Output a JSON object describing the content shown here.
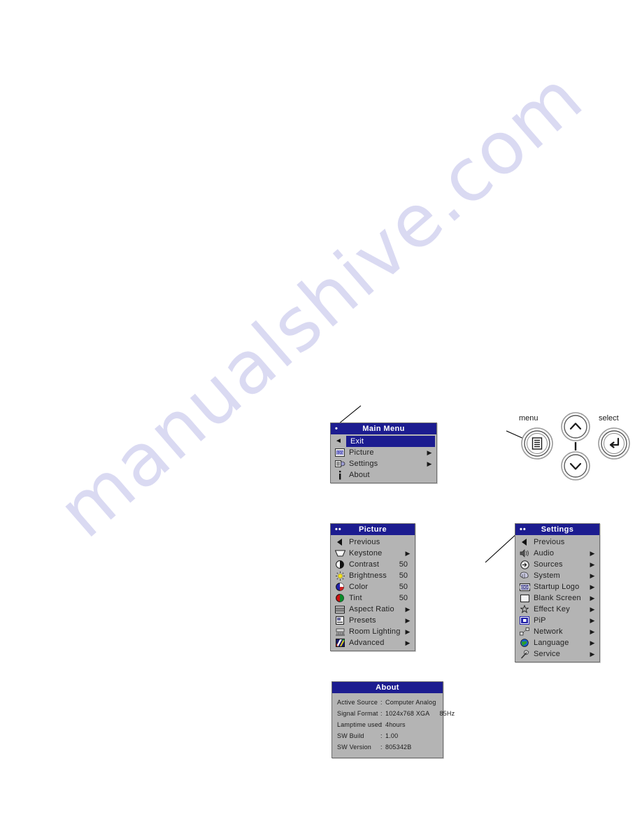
{
  "watermark": {
    "text": "manualshive.com"
  },
  "colors": {
    "title_bar": "#1c1c90",
    "panel_bg": "#b4b4b4",
    "highlight": "#1c1c90",
    "panel_border": "#6e6e6e"
  },
  "main_menu": {
    "title": "Main Menu",
    "title_dots": "•",
    "items": [
      {
        "label": "Exit",
        "icon": "left-arrow-icon",
        "arrow": "",
        "selected": true
      },
      {
        "label": "Picture",
        "icon": "picture-icon",
        "arrow": "▶",
        "selected": false
      },
      {
        "label": "Settings",
        "icon": "settings-icon",
        "arrow": "▶",
        "selected": false
      },
      {
        "label": "About",
        "icon": "info-icon",
        "arrow": "",
        "selected": false
      }
    ]
  },
  "picture_menu": {
    "title": "Picture",
    "title_dots": "••",
    "items": [
      {
        "label": "Previous",
        "icon": "left-arrow-icon",
        "value": "",
        "arrow": ""
      },
      {
        "label": "Keystone",
        "icon": "keystone-icon",
        "value": "",
        "arrow": "▶"
      },
      {
        "label": "Contrast",
        "icon": "contrast-icon",
        "value": "50",
        "arrow": ""
      },
      {
        "label": "Brightness",
        "icon": "brightness-icon",
        "value": "50",
        "arrow": ""
      },
      {
        "label": "Color",
        "icon": "color-icon",
        "value": "50",
        "arrow": ""
      },
      {
        "label": "Tint",
        "icon": "tint-icon",
        "value": "50",
        "arrow": ""
      },
      {
        "label": "Aspect Ratio",
        "icon": "aspect-ratio-icon",
        "value": "",
        "arrow": "▶"
      },
      {
        "label": "Presets",
        "icon": "presets-icon",
        "value": "",
        "arrow": "▶"
      },
      {
        "label": "Room Lighting",
        "icon": "room-lighting-icon",
        "value": "",
        "arrow": "▶"
      },
      {
        "label": "Advanced",
        "icon": "advanced-icon",
        "value": "",
        "arrow": "▶"
      }
    ]
  },
  "settings_menu": {
    "title": "Settings",
    "title_dots": "••",
    "items": [
      {
        "label": "Previous",
        "icon": "left-arrow-icon",
        "arrow": ""
      },
      {
        "label": "Audio",
        "icon": "audio-icon",
        "arrow": "▶"
      },
      {
        "label": "Sources",
        "icon": "sources-icon",
        "arrow": "▶"
      },
      {
        "label": "System",
        "icon": "system-icon",
        "arrow": "▶"
      },
      {
        "label": "Startup Logo",
        "icon": "startup-logo-icon",
        "arrow": "▶"
      },
      {
        "label": "Blank Screen",
        "icon": "blank-screen-icon",
        "arrow": "▶"
      },
      {
        "label": "Effect Key",
        "icon": "star-icon",
        "arrow": "▶"
      },
      {
        "label": "PiP",
        "icon": "pip-icon",
        "arrow": "▶"
      },
      {
        "label": "Network",
        "icon": "network-icon",
        "arrow": "▶"
      },
      {
        "label": "Language",
        "icon": "globe-icon",
        "arrow": "▶"
      },
      {
        "label": "Service",
        "icon": "wrench-icon",
        "arrow": "▶"
      }
    ]
  },
  "about_panel": {
    "title": "About",
    "lines": [
      {
        "key": "Active Source",
        "sep": ":",
        "value": "Computer Analog",
        "value2": ""
      },
      {
        "key": "Signal Format",
        "sep": ":",
        "value": "1024x768 XGA",
        "value2": "85Hz"
      },
      {
        "key": "Lamptime used",
        "sep": ":",
        "value": "4hours",
        "value2": ""
      },
      {
        "key": "SW Build",
        "sep": ":",
        "value": "1.00",
        "value2": ""
      },
      {
        "key": "SW Version",
        "sep": ":",
        "value": "805342B",
        "value2": ""
      }
    ]
  },
  "keypad": {
    "menu_label": "menu",
    "select_label": "select",
    "buttons": [
      {
        "name": "menu-button",
        "icon": "menu-lines-icon"
      },
      {
        "name": "up-button",
        "icon": "chevron-up-icon"
      },
      {
        "name": "down-button",
        "icon": "chevron-down-icon"
      },
      {
        "name": "select-button",
        "icon": "enter-arrow-icon"
      }
    ]
  }
}
